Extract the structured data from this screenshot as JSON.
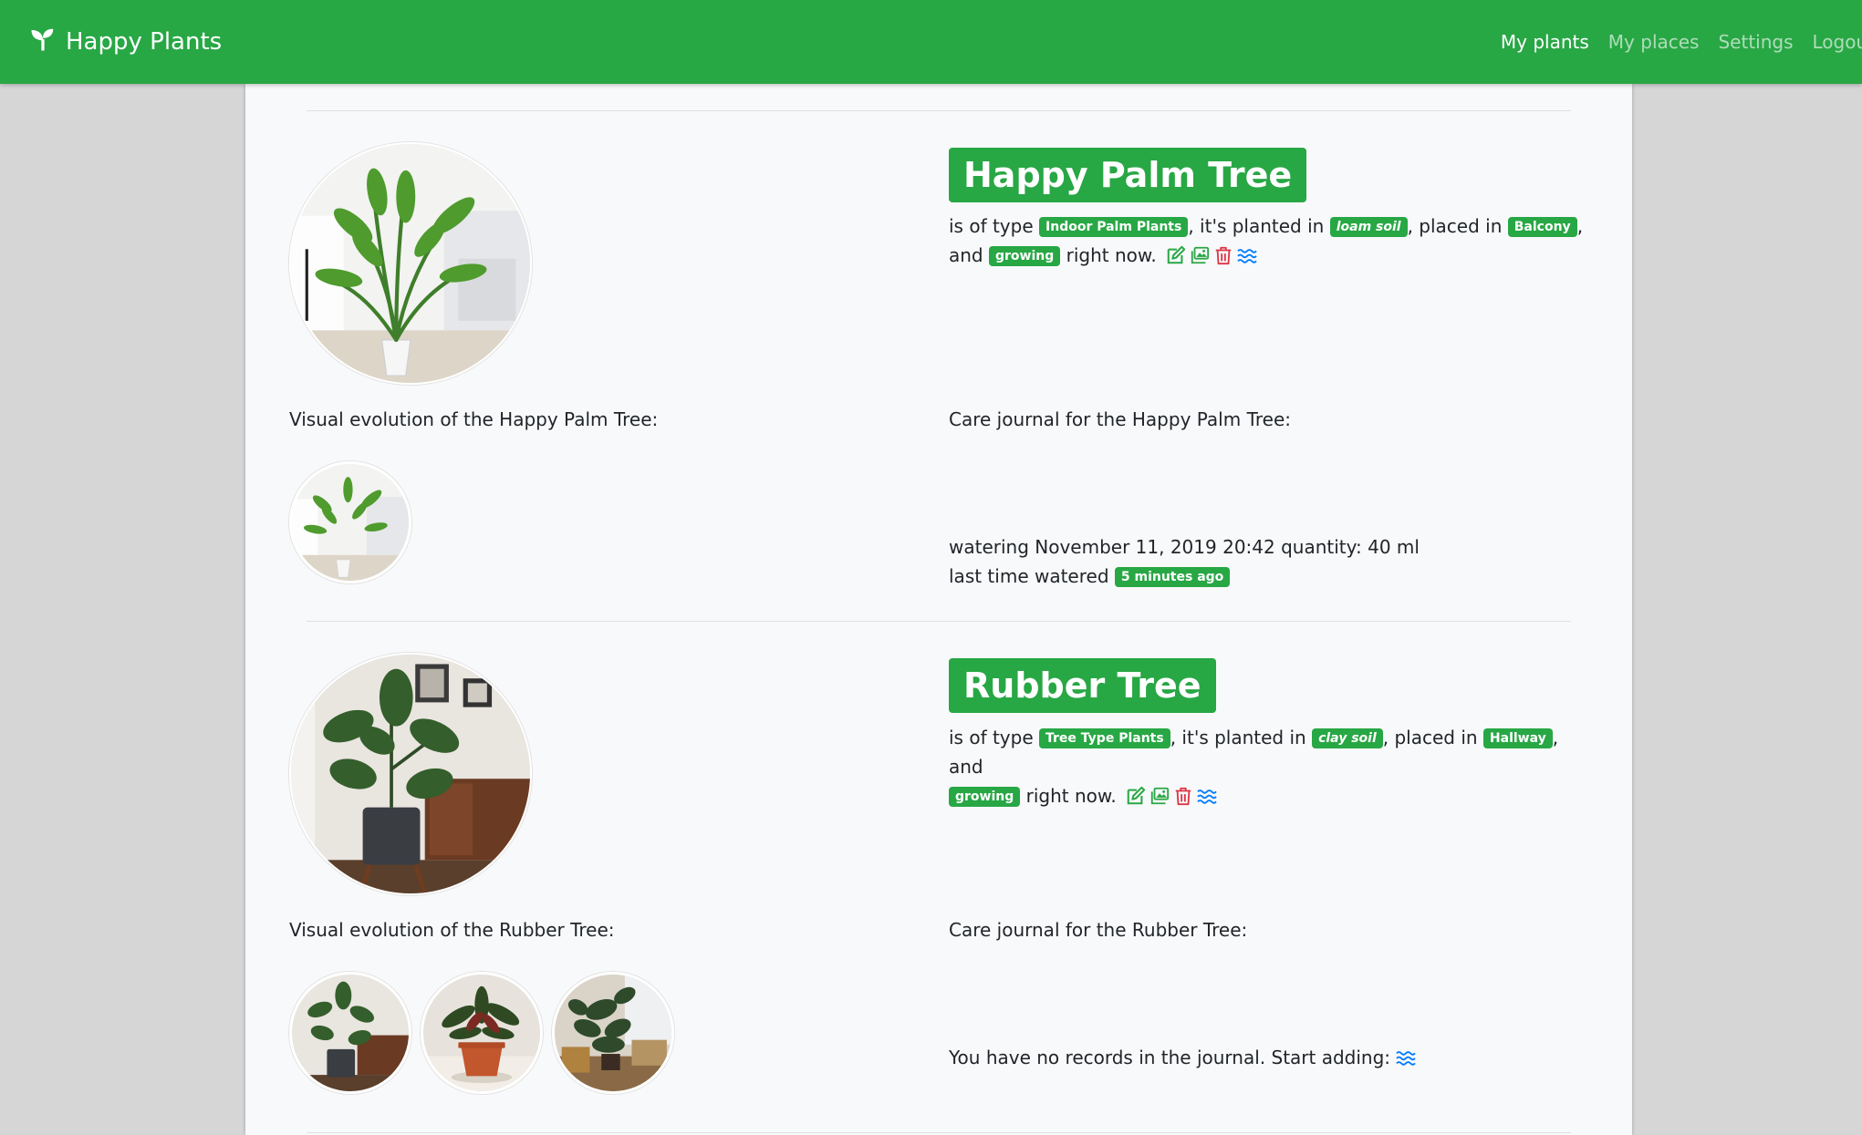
{
  "navbar": {
    "brand": "Happy Plants",
    "links": [
      "My plants",
      "My places",
      "Settings",
      "Logout"
    ]
  },
  "plants": [
    {
      "name": "Happy Palm Tree",
      "desc": {
        "p1": "is of type ",
        "type": "Indoor Palm Plants",
        "p2": ", it's planted in ",
        "soil": "loam soil",
        "p3": ", placed in ",
        "place": "Balcony",
        "p4": ",",
        "p5": "and ",
        "status": "growing",
        "p6": " right now."
      },
      "evolution_label": "Visual evolution of the Happy Palm Tree:",
      "journal_label": "Care journal for the Happy Palm Tree:",
      "journal": {
        "entry": "watering November 11, 2019 20:42 quantity: 40 ml",
        "last_watered_label": "last time watered ",
        "last_watered_badge": "5 minutes ago"
      }
    },
    {
      "name": "Rubber Tree",
      "desc": {
        "p1": "is of type ",
        "type": "Tree Type Plants",
        "p2": ", it's planted in ",
        "soil": "clay soil",
        "p3": ", placed in ",
        "place": "Hallway",
        "p4": ", and",
        "status": "growing",
        "p6": " right now."
      },
      "evolution_label": "Visual evolution of the Rubber Tree:",
      "journal_label": "Care journal for the Rubber Tree:",
      "journal": {
        "empty": "You have no records in the journal. Start adding: "
      }
    }
  ],
  "icons": {
    "brand": "sprout-icon",
    "actions": [
      "edit-icon",
      "gallery-icon",
      "trash-icon",
      "water-icon"
    ]
  },
  "colors": {
    "primary": "#28a745",
    "danger": "#dc3545",
    "info": "#007bff"
  }
}
